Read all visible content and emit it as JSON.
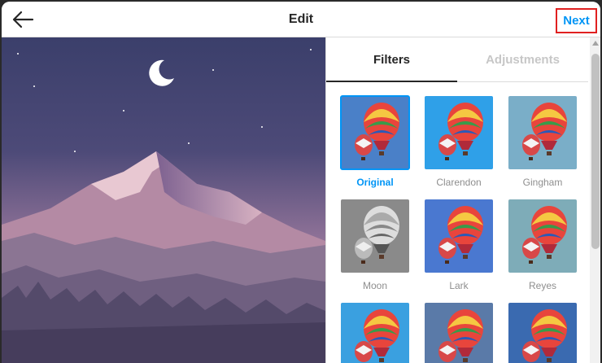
{
  "header": {
    "title": "Edit",
    "next_label": "Next",
    "back_icon": "arrow-left-icon"
  },
  "tabs": [
    {
      "label": "Filters",
      "active": true
    },
    {
      "label": "Adjustments",
      "active": false
    }
  ],
  "filters": [
    {
      "label": "Original",
      "selected": true,
      "bg": "#4a80c8"
    },
    {
      "label": "Clarendon",
      "selected": false,
      "bg": "#2fa0e8"
    },
    {
      "label": "Gingham",
      "selected": false,
      "bg": "#7aaec8"
    },
    {
      "label": "Moon",
      "selected": false,
      "bg": "#8a8a8a"
    },
    {
      "label": "Lark",
      "selected": false,
      "bg": "#4a78d0"
    },
    {
      "label": "Reyes",
      "selected": false,
      "bg": "#7eacb8"
    },
    {
      "label": "",
      "selected": false,
      "bg": "#3aa0e0"
    },
    {
      "label": "",
      "selected": false,
      "bg": "#5a7aa8"
    },
    {
      "label": "",
      "selected": false,
      "bg": "#3a6ab0"
    }
  ],
  "colors": {
    "accent": "#0095f6",
    "highlight_border": "#e02020"
  }
}
